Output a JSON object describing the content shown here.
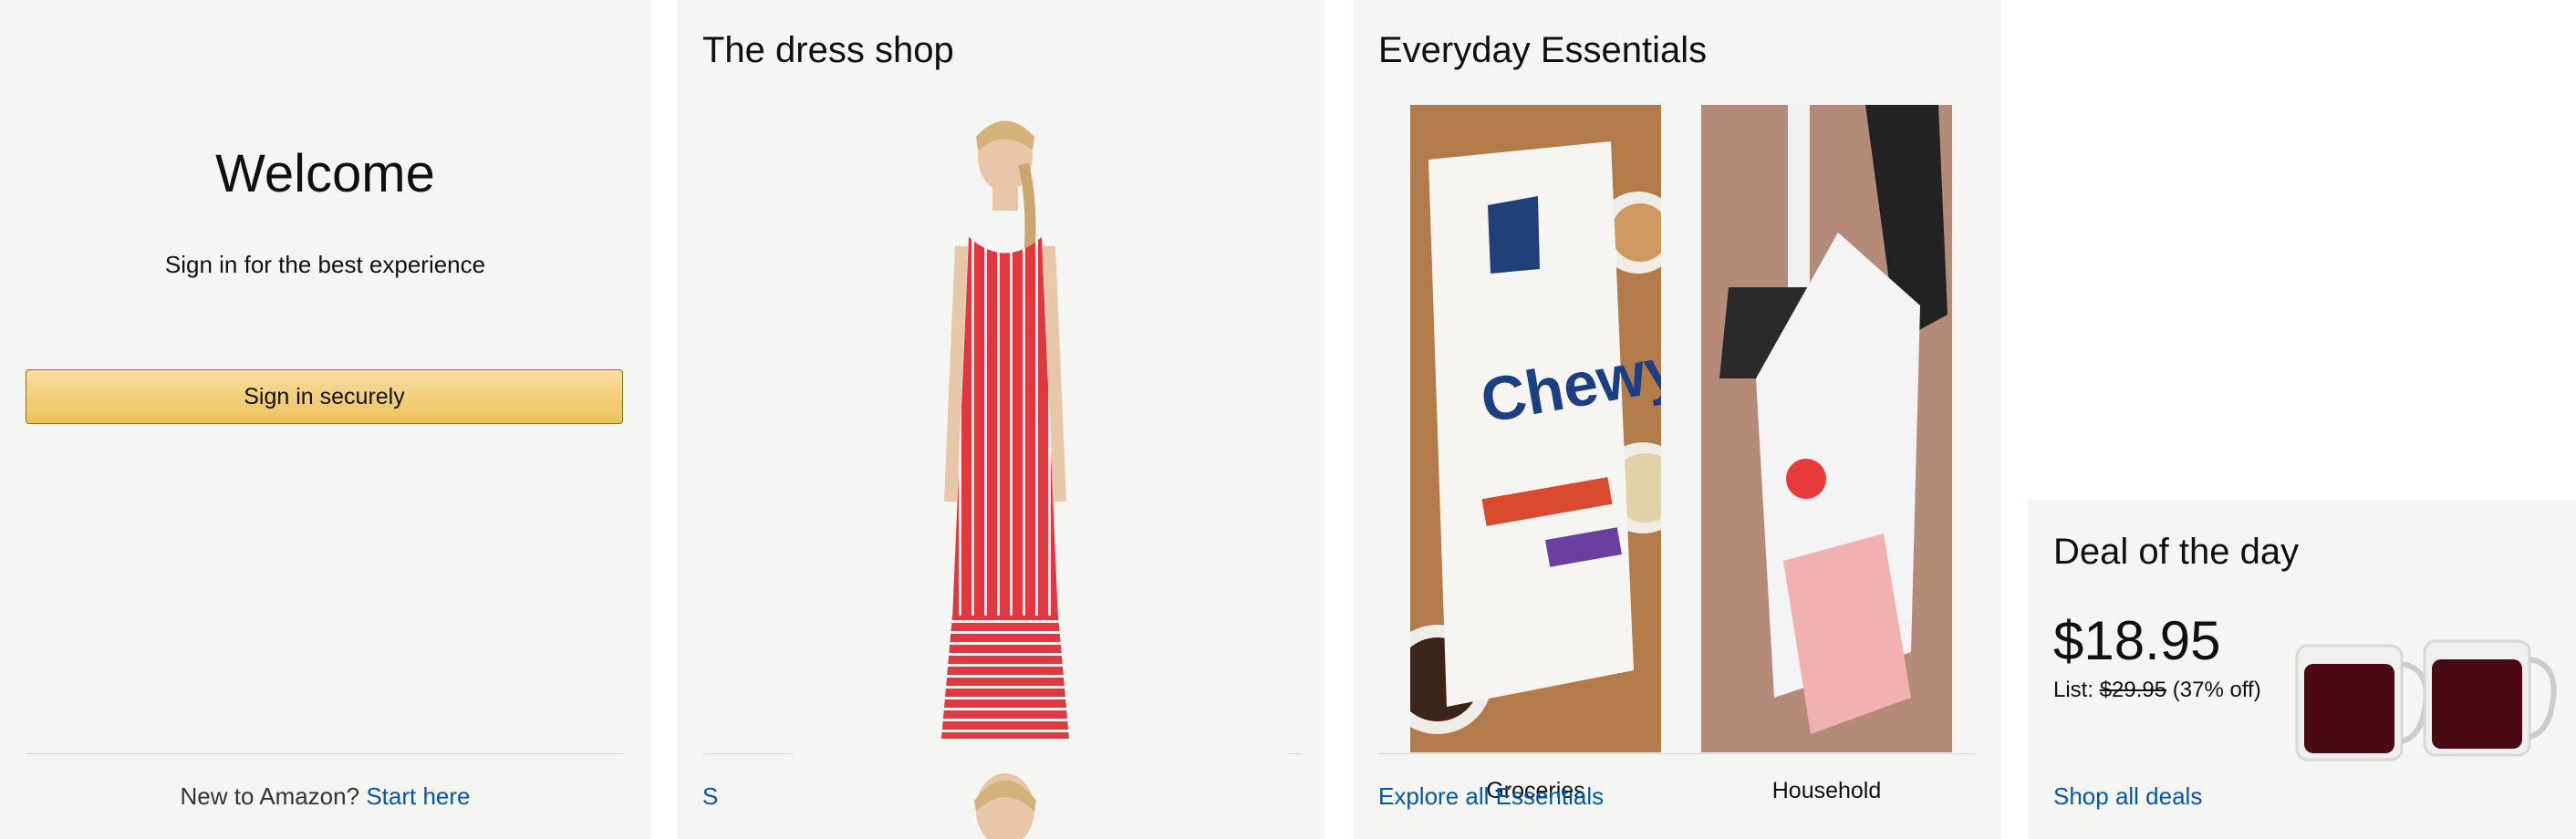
{
  "welcome_card": {
    "heading": "Welcome",
    "subheading": "Sign in for the best experience",
    "signin_button": "Sign in securely",
    "new_prompt": "New to Amazon?",
    "start_link": "Start here"
  },
  "dress_card": {
    "title": "The dress shop",
    "link": "S",
    "image_icon": "red-striped-dress-photo"
  },
  "essentials_card": {
    "title": "Everyday Essentials",
    "tiles": [
      {
        "label": "Groceries",
        "icon": "cereal-box-photo"
      },
      {
        "label": "Household",
        "icon": "dustpan-photo"
      }
    ],
    "explore_link": "Explore all Essentials"
  },
  "deal_card": {
    "title": "Deal of the day",
    "price": "$18.95",
    "list_prefix": "List:",
    "list_price": "$29.95",
    "discount": "(37% off)",
    "shop_link": "Shop all deals",
    "image_icon": "glass-mugs-photo"
  },
  "colors": {
    "card_bg": "#f5f5f3",
    "button_gradient_top": "#f7dea1",
    "button_gradient_bottom": "#eec25a",
    "link": "#0756a6"
  }
}
